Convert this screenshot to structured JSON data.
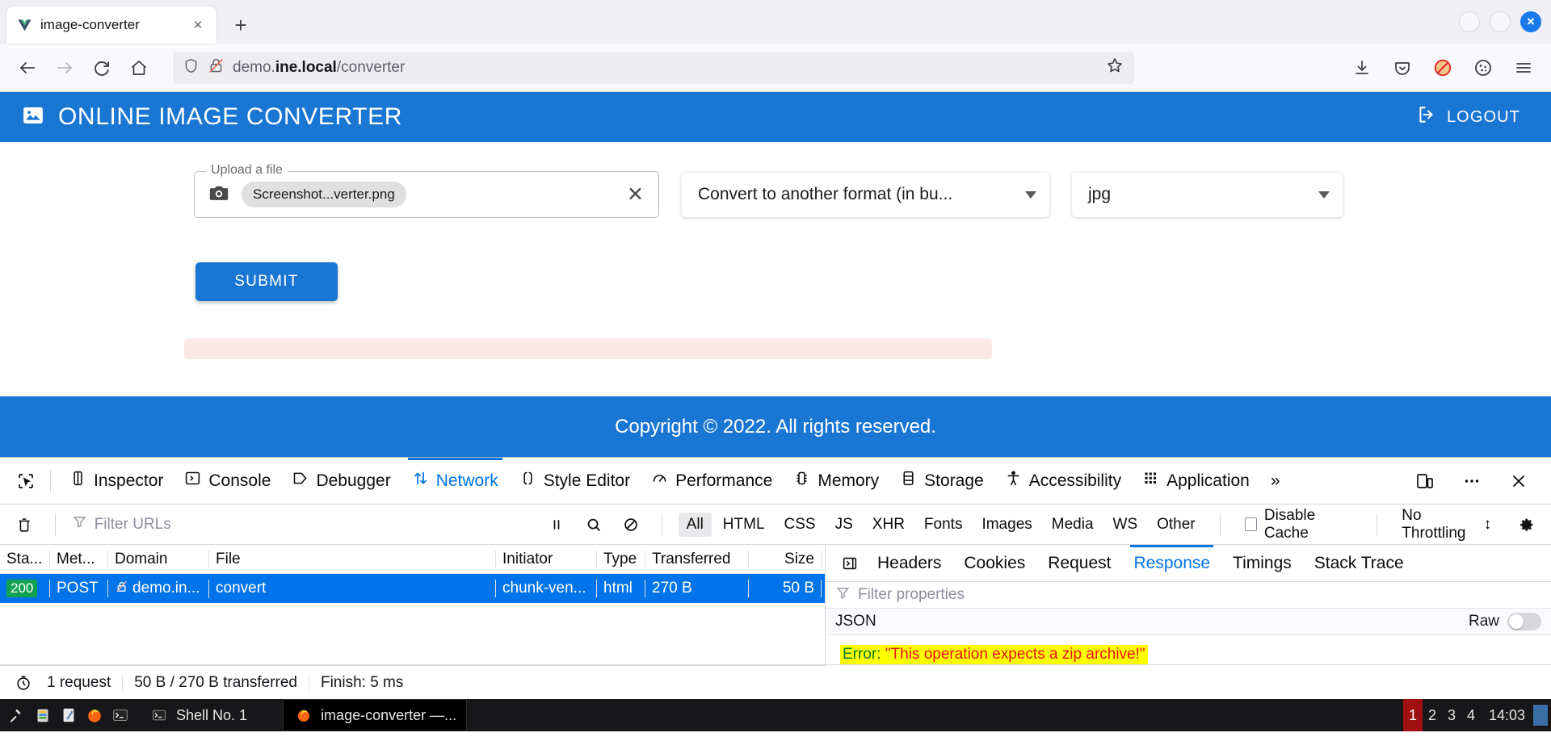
{
  "browser": {
    "tab": {
      "title": "image-converter",
      "favicon": "vue-logo-icon",
      "close_label": "×"
    },
    "new_tab_label": "+",
    "window_buttons": {
      "minimize": "",
      "maximize": "",
      "close": "×"
    },
    "nav": {
      "back": "←",
      "forward": "→",
      "reload": "⟳",
      "home": "⌂"
    },
    "url": {
      "prefix": "demo.",
      "host": "ine.local",
      "path": "/converter",
      "full": "demo.ine.local/converter"
    },
    "toolbar_icons": [
      "download-icon",
      "pocket-icon",
      "no-ads-icon",
      "cookie-icon",
      "hamburger-menu-icon"
    ]
  },
  "app": {
    "header": {
      "title": "ONLINE IMAGE CONVERTER",
      "logo": "image-icon",
      "logout_label": "LOGOUT",
      "logout_icon": "logout-icon",
      "accent": "#1976d2"
    },
    "form": {
      "file_field": {
        "legend": "Upload a file",
        "chip_value": "Screenshot...verter.png",
        "camera_icon": "camera-icon",
        "clear_label": "✕"
      },
      "operation_select": {
        "value": "Convert to another format (in bu..."
      },
      "format_select": {
        "value": "jpg"
      },
      "submit_label": "SUBMIT"
    },
    "footer": {
      "text": "Copyright © 2022. All rights reserved."
    }
  },
  "devtools": {
    "tabs": [
      {
        "label": "Inspector",
        "icon": "inspector-icon",
        "active": false
      },
      {
        "label": "Console",
        "icon": "console-icon",
        "active": false
      },
      {
        "label": "Debugger",
        "icon": "debugger-icon",
        "active": false
      },
      {
        "label": "Network",
        "icon": "network-icon",
        "active": true
      },
      {
        "label": "Style Editor",
        "icon": "style-editor-icon",
        "active": false
      },
      {
        "label": "Performance",
        "icon": "performance-icon",
        "active": false
      },
      {
        "label": "Memory",
        "icon": "memory-icon",
        "active": false
      },
      {
        "label": "Storage",
        "icon": "storage-icon",
        "active": false
      },
      {
        "label": "Accessibility",
        "icon": "accessibility-icon",
        "active": false
      },
      {
        "label": "Application",
        "icon": "application-icon",
        "active": false
      }
    ],
    "overflow_label": "»",
    "right_icons": [
      "responsive-design-mode-icon",
      "devtools-meatball-menu-icon",
      "close-devtools-icon"
    ],
    "network": {
      "trash_icon": "trash-icon",
      "filter_placeholder": "Filter URLs",
      "pause_icon": "pause-icon",
      "search_icon": "search-icon",
      "block_icon": "block-icon",
      "type_filters": [
        "All",
        "HTML",
        "CSS",
        "JS",
        "XHR",
        "Fonts",
        "Images",
        "Media",
        "WS",
        "Other"
      ],
      "active_type_filter": "All",
      "disable_cache_label": "Disable Cache",
      "throttling_label": "No Throttling",
      "settings_icon": "gear-icon",
      "columns": [
        "Sta...",
        "Met...",
        "Domain",
        "File",
        "Initiator",
        "Type",
        "Transferred",
        "Size"
      ],
      "rows": [
        {
          "status": "200",
          "method": "POST",
          "domain": "demo.in...",
          "domain_icon": "insecure-lock-icon",
          "file": "convert",
          "initiator": "chunk-ven...",
          "type": "html",
          "transferred": "270 B",
          "size": "50 B",
          "selected": true
        }
      ],
      "status_bar": [
        "1 request",
        "50 B / 270 B transferred",
        "Finish: 5 ms"
      ],
      "status_icon": "timer-icon"
    },
    "details": {
      "expand_icon": "expand-panel-icon",
      "tabs": [
        "Headers",
        "Cookies",
        "Request",
        "Response",
        "Timings",
        "Stack Trace"
      ],
      "active_tab": "Response",
      "filter_placeholder": "Filter properties",
      "json_label": "JSON",
      "raw_label": "Raw",
      "raw_on": false,
      "response_key": "Error:",
      "response_value": "\"This operation expects a zip archive!\""
    }
  },
  "taskbar": {
    "icons": [
      "tool-icon",
      "files-icon",
      "editor-icon",
      "firefox-icon",
      "terminal-icon"
    ],
    "shell_icon": "terminal-icon",
    "shell_label": "Shell No. 1",
    "window_icon": "firefox-icon",
    "window_label": "image-converter —...",
    "desktops": [
      "1",
      "2",
      "3",
      "4"
    ],
    "active_desktop": "1",
    "clock": "14:03"
  }
}
